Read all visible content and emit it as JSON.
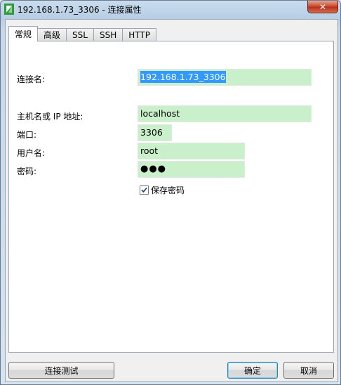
{
  "window": {
    "title": "192.168.1.73_3306 - 连接属性",
    "close_symbol": "✕"
  },
  "tabs": [
    {
      "label": "常规",
      "active": true
    },
    {
      "label": "高级",
      "active": false
    },
    {
      "label": "SSL",
      "active": false
    },
    {
      "label": "SSH",
      "active": false
    },
    {
      "label": "HTTP",
      "active": false
    }
  ],
  "form": {
    "connection_name_label": "连接名:",
    "connection_name_value": "192.168.1.73_3306",
    "host_label": "主机名或 IP 地址:",
    "host_value": "localhost",
    "port_label": "端口:",
    "port_value": "3306",
    "user_label": "用户名:",
    "user_value": "root",
    "password_label": "密码:",
    "password_value": "●●●",
    "save_password_label": "保存密码",
    "save_password_checked": true
  },
  "buttons": {
    "test_connection": "连接测试",
    "ok": "确定",
    "cancel": "取消"
  },
  "colors": {
    "field_bg": "#c9efcb",
    "selection": "#3399ff",
    "close_button": "#c8452b"
  }
}
